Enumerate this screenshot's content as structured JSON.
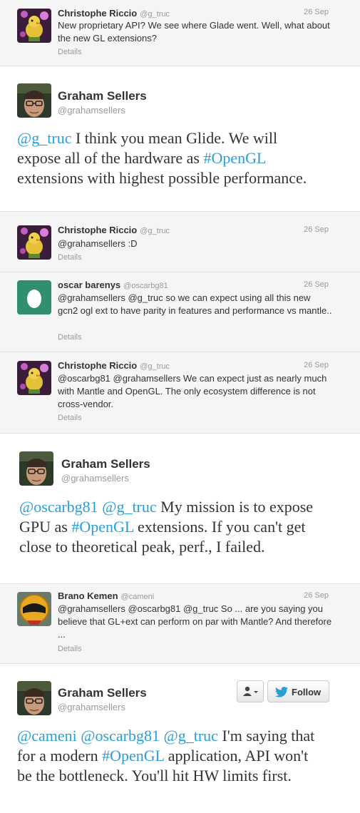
{
  "colors": {
    "link": "#2a9fd6",
    "name": "#333333",
    "muted": "#999999",
    "reply_bg": "#f5f5f5"
  },
  "thread": [
    {
      "kind": "reply",
      "avatar_icon": "bird-avatar-icon",
      "name": "Christophe Riccio",
      "handle": "@g_truc",
      "date": "26 Sep",
      "text": "New proprietary API? We see where Glade went. Well, what about the new GL extensions?",
      "details": "Details"
    },
    {
      "kind": "main",
      "avatar_icon": "glasses-portrait-avatar-icon",
      "name": "Graham Sellers",
      "handle": "@grahamsellers",
      "text_parts": [
        {
          "t": "@g_truc",
          "link": true
        },
        {
          "t": " I think you mean Glide. We will expose all of the hardware as ",
          "link": false
        },
        {
          "t": "#OpenGL",
          "link": true
        },
        {
          "t": " extensions with highest possible performance.",
          "link": false
        }
      ]
    },
    {
      "kind": "reply",
      "avatar_icon": "bird-avatar-icon",
      "name": "Christophe Riccio",
      "handle": "@g_truc",
      "date": "26 Sep",
      "text": "@grahamsellers :D",
      "details": "Details"
    },
    {
      "kind": "reply",
      "avatar_icon": "egg-avatar-icon",
      "name": "oscar barenys",
      "handle": "@oscarbg81",
      "date": "26 Sep",
      "text": "@grahamsellers @g_truc so we can expect using all this new gcn2 ogl ext to have parity in features and performance vs mantle..",
      "details": "Details"
    },
    {
      "kind": "reply",
      "avatar_icon": "bird-avatar-icon",
      "name": "Christophe Riccio",
      "handle": "@g_truc",
      "date": "26 Sep",
      "text": "@oscarbg81 @grahamsellers We can expect just as nearly much with Mantle and OpenGL. The only ecosystem difference is not cross-vendor.",
      "details": "Details"
    },
    {
      "kind": "main",
      "avatar_icon": "glasses-portrait-avatar-icon",
      "name": "Graham Sellers",
      "handle": "@grahamsellers",
      "text_parts": [
        {
          "t": "@oscarbg81",
          "link": true
        },
        {
          "t": " ",
          "link": false
        },
        {
          "t": "@g_truc",
          "link": true
        },
        {
          "t": " My mission is to expose GPU as ",
          "link": false
        },
        {
          "t": "#OpenGL",
          "link": true
        },
        {
          "t": " extensions. If you can't get close to theoretical peak, perf., I failed.",
          "link": false
        }
      ]
    },
    {
      "kind": "reply",
      "avatar_icon": "helmet-avatar-icon",
      "name": "Brano Kemen",
      "handle": "@cameni",
      "date": "26 Sep",
      "text": "@grahamsellers @oscarbg81 @g_truc So ... are you saying you believe that GL+ext can perform on par with Mantle? And therefore ...",
      "details": "Details"
    },
    {
      "kind": "main",
      "avatar_icon": "glasses-portrait-avatar-icon",
      "name": "Graham Sellers",
      "handle": "@grahamsellers",
      "follow_label": "Follow",
      "user_menu_icon": "user-dropdown-icon",
      "text_parts": [
        {
          "t": "@cameni",
          "link": true
        },
        {
          "t": " ",
          "link": false
        },
        {
          "t": "@oscarbg81",
          "link": true
        },
        {
          "t": " ",
          "link": false
        },
        {
          "t": "@g_truc",
          "link": true
        },
        {
          "t": " I'm saying that for a modern ",
          "link": false
        },
        {
          "t": "#OpenGL",
          "link": true
        },
        {
          "t": " application, API won't be the bottleneck. You'll hit HW limits first.",
          "link": false
        }
      ]
    }
  ]
}
